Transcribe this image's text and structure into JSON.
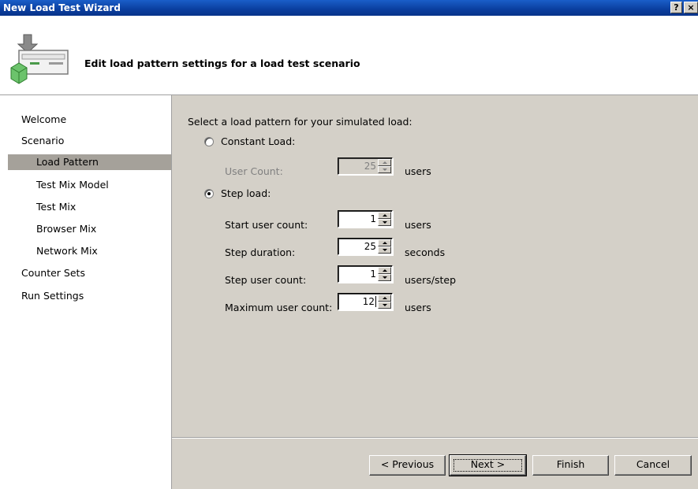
{
  "window": {
    "title": "New Load Test Wizard",
    "help_label": "?",
    "close_label": "×"
  },
  "header": {
    "title": "Edit load pattern settings for a load test scenario",
    "icon": "wizard-package-icon"
  },
  "nav": {
    "items": [
      {
        "label": "Welcome",
        "level": 0,
        "selected": false
      },
      {
        "label": "Scenario",
        "level": 0,
        "selected": false
      },
      {
        "label": "Load Pattern",
        "level": 1,
        "selected": true
      },
      {
        "label": "Test Mix Model",
        "level": 1,
        "selected": false
      },
      {
        "label": "Test Mix",
        "level": 1,
        "selected": false
      },
      {
        "label": "Browser Mix",
        "level": 1,
        "selected": false
      },
      {
        "label": "Network Mix",
        "level": 1,
        "selected": false
      },
      {
        "label": "Counter Sets",
        "level": 0,
        "selected": false
      },
      {
        "label": "Run Settings",
        "level": 0,
        "selected": false
      }
    ]
  },
  "form": {
    "prompt": "Select a load pattern for your simulated load:",
    "constant": {
      "label": "Constant Load:",
      "selected": false,
      "user_count_label": "User Count:",
      "user_count_value": "25",
      "user_count_unit": "users"
    },
    "step": {
      "label": "Step load:",
      "selected": true,
      "start_label": "Start user count:",
      "start_value": "1",
      "start_unit": "users",
      "duration_label": "Step duration:",
      "duration_value": "25",
      "duration_unit": "seconds",
      "step_count_label": "Step user count:",
      "step_count_value": "1",
      "step_count_unit": "users/step",
      "max_label": "Maximum user count:",
      "max_value": "12",
      "max_unit": "users"
    }
  },
  "buttons": {
    "previous": "< Previous",
    "next": "Next >",
    "finish": "Finish",
    "cancel": "Cancel"
  },
  "colors": {
    "titlebar": "#0a3e9e",
    "panel": "#d4d0c8",
    "nav_selected": "#a5a19a"
  }
}
